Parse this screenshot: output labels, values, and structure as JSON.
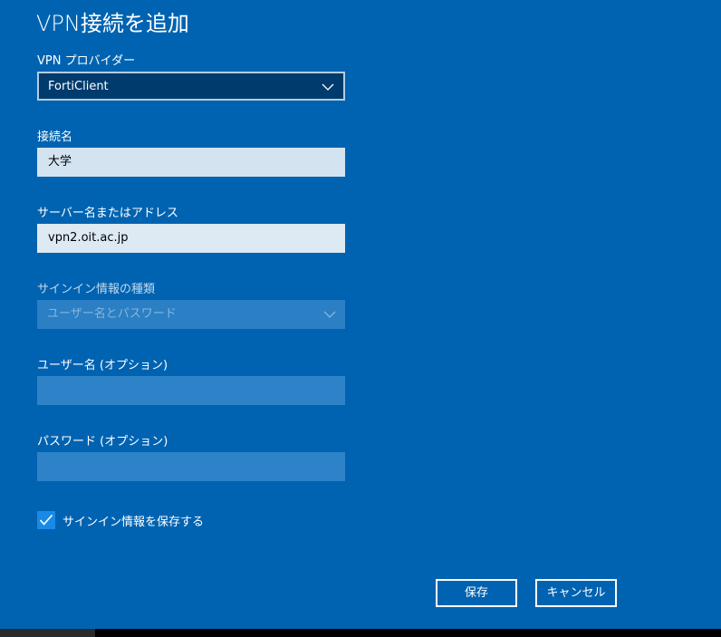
{
  "dialog": {
    "title": "VPN接続を追加",
    "provider": {
      "label": "VPN プロバイダー",
      "value": "FortiClient",
      "chevron_icon": "chevron-down-icon"
    },
    "connection_name": {
      "label": "接続名",
      "value": "大学"
    },
    "server": {
      "label": "サーバー名またはアドレス",
      "value": "vpn2.oit.ac.jp"
    },
    "signin_type": {
      "label": "サインイン情報の種類",
      "value": "ユーザー名とパスワード",
      "disabled": true
    },
    "username": {
      "label": "ユーザー名 (オプション)",
      "value": ""
    },
    "password": {
      "label": "パスワード (オプション)",
      "value": ""
    },
    "remember": {
      "label": "サインイン情報を保存する",
      "checked": true
    },
    "buttons": {
      "save": "保存",
      "cancel": "キャンセル"
    }
  },
  "colors": {
    "background": "#0063b1",
    "accent": "#1a8ae8",
    "field_filled": "#d3e3f0",
    "field_empty": "#2e82c7"
  }
}
